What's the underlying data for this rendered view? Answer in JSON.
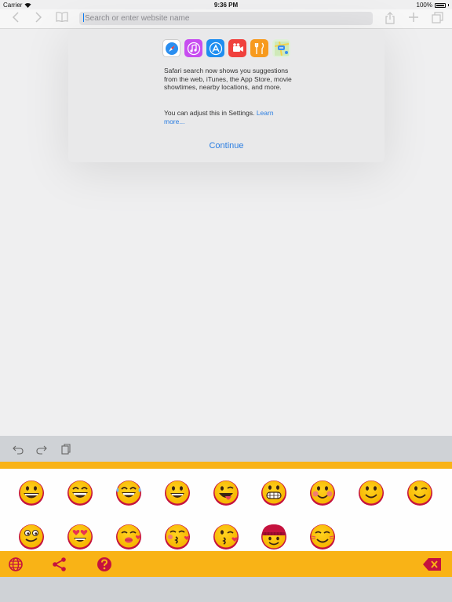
{
  "status": {
    "carrier": "Carrier",
    "time": "9:36 PM",
    "battery": "100%"
  },
  "toolbar": {
    "back_icon": "chevron-left-icon",
    "forward_icon": "chevron-right-icon",
    "bookmarks_icon": "book-icon",
    "url_placeholder": "Search or enter website name",
    "share_icon": "share-icon",
    "new_tab_icon": "plus-icon",
    "tabs_icon": "tabs-icon"
  },
  "popover": {
    "app_icons": [
      "safari-icon",
      "itunes-icon",
      "app-store-icon",
      "movies-icon",
      "restaurants-icon",
      "maps-icon"
    ],
    "message": "Safari search now shows you suggestions from the web, iTunes, the App Store, movie showtimes, nearby locations, and more.",
    "settings_text": "You can adjust this in Settings. ",
    "learn_more": "Learn more...",
    "continue_label": "Continue"
  },
  "keyboard": {
    "undo_icon": "undo-icon",
    "redo_icon": "redo-icon",
    "paste_icon": "clipboard-icon",
    "emoji_row1": [
      "grinning-face",
      "laughing-face",
      "tears-of-joy-face",
      "open-smile-face",
      "winking-tongue-face",
      "teeth-grin-face",
      "blushing-face",
      "smiling-face",
      "winking-face"
    ],
    "emoji_row2": [
      "goofy-face",
      "heart-eyes-face",
      "kissing-lips-face",
      "kissing-heart-face",
      "blowing-kiss-face",
      "beanie-face",
      "squinting-blush-face"
    ],
    "globe_icon": "globe-icon",
    "share_icon": "share-nodes-icon",
    "help_icon": "question-icon",
    "delete_icon": "backspace-icon",
    "accent_color": "#f9b316",
    "icon_color": "#c5123e"
  }
}
